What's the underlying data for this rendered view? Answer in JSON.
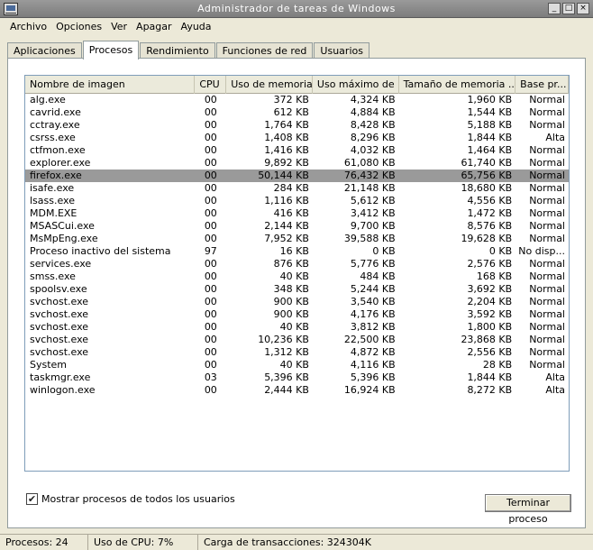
{
  "window": {
    "title": "Administrador de tareas de Windows"
  },
  "titlebar_buttons": [
    "_",
    "□",
    "×"
  ],
  "menu": [
    "Archivo",
    "Opciones",
    "Ver",
    "Apagar",
    "Ayuda"
  ],
  "tabs": [
    {
      "label": "Aplicaciones"
    },
    {
      "label": "Procesos"
    },
    {
      "label": "Rendimiento"
    },
    {
      "label": "Funciones de red"
    },
    {
      "label": "Usuarios"
    }
  ],
  "table": {
    "headers": [
      "Nombre de imagen",
      "CPU",
      "Uso de memoria",
      "Uso máximo de ...",
      "Tamaño de memoria ...",
      "Base pr..."
    ],
    "rows": [
      [
        "alg.exe",
        "00",
        "372 KB",
        "4,324 KB",
        "1,960 KB",
        "Normal"
      ],
      [
        "cavrid.exe",
        "00",
        "612 KB",
        "4,884 KB",
        "1,544 KB",
        "Normal"
      ],
      [
        "cctray.exe",
        "00",
        "1,764 KB",
        "8,428 KB",
        "5,188 KB",
        "Normal"
      ],
      [
        "csrss.exe",
        "00",
        "1,408 KB",
        "8,296 KB",
        "1,844 KB",
        "Alta"
      ],
      [
        "ctfmon.exe",
        "00",
        "1,416 KB",
        "4,032 KB",
        "1,464 KB",
        "Normal"
      ],
      [
        "explorer.exe",
        "00",
        "9,892 KB",
        "61,080 KB",
        "61,740 KB",
        "Normal"
      ],
      [
        "firefox.exe",
        "00",
        "50,144 KB",
        "76,432 KB",
        "65,756 KB",
        "Normal"
      ],
      [
        "isafe.exe",
        "00",
        "284 KB",
        "21,148 KB",
        "18,680 KB",
        "Normal"
      ],
      [
        "lsass.exe",
        "00",
        "1,116 KB",
        "5,612 KB",
        "4,556 KB",
        "Normal"
      ],
      [
        "MDM.EXE",
        "00",
        "416 KB",
        "3,412 KB",
        "1,472 KB",
        "Normal"
      ],
      [
        "MSASCui.exe",
        "00",
        "2,144 KB",
        "9,700 KB",
        "8,576 KB",
        "Normal"
      ],
      [
        "MsMpEng.exe",
        "00",
        "7,952 KB",
        "39,588 KB",
        "19,628 KB",
        "Normal"
      ],
      [
        "Proceso inactivo del sistema",
        "97",
        "16 KB",
        "0 KB",
        "0 KB",
        "No disp..."
      ],
      [
        "services.exe",
        "00",
        "876 KB",
        "5,776 KB",
        "2,576 KB",
        "Normal"
      ],
      [
        "smss.exe",
        "00",
        "40 KB",
        "484 KB",
        "168 KB",
        "Normal"
      ],
      [
        "spoolsv.exe",
        "00",
        "348 KB",
        "5,244 KB",
        "3,692 KB",
        "Normal"
      ],
      [
        "svchost.exe",
        "00",
        "900 KB",
        "3,540 KB",
        "2,204 KB",
        "Normal"
      ],
      [
        "svchost.exe",
        "00",
        "900 KB",
        "4,176 KB",
        "3,592 KB",
        "Normal"
      ],
      [
        "svchost.exe",
        "00",
        "40 KB",
        "3,812 KB",
        "1,800 KB",
        "Normal"
      ],
      [
        "svchost.exe",
        "00",
        "10,236 KB",
        "22,500 KB",
        "23,868 KB",
        "Normal"
      ],
      [
        "svchost.exe",
        "00",
        "1,312 KB",
        "4,872 KB",
        "2,556 KB",
        "Normal"
      ],
      [
        "System",
        "00",
        "40 KB",
        "4,116 KB",
        "28 KB",
        "Normal"
      ],
      [
        "taskmgr.exe",
        "03",
        "5,396 KB",
        "5,396 KB",
        "1,844 KB",
        "Alta"
      ],
      [
        "winlogon.exe",
        "00",
        "2,444 KB",
        "16,924 KB",
        "8,272 KB",
        "Alta"
      ]
    ]
  },
  "show_all_users": {
    "label": "Mostrar procesos de todos los usuarios",
    "check_glyph": "✔"
  },
  "end_process_button": {
    "label": "Terminar proceso"
  },
  "status": {
    "processes": "Procesos: 24",
    "cpu": "Uso de CPU: 7%",
    "commit": "Carga de transacciones: 324304K"
  }
}
